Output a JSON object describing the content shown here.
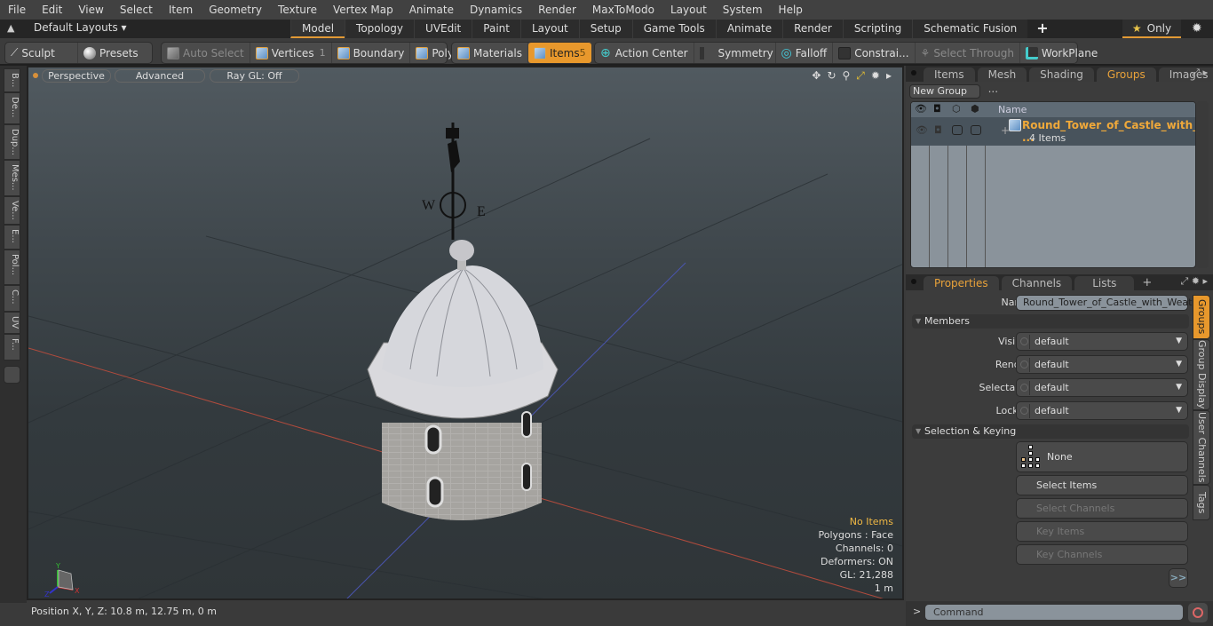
{
  "menubar": [
    "File",
    "Edit",
    "View",
    "Select",
    "Item",
    "Geometry",
    "Texture",
    "Vertex Map",
    "Animate",
    "Dynamics",
    "Render",
    "MaxToModo",
    "Layout",
    "System",
    "Help"
  ],
  "layoutbar": {
    "layout_select": "Default Layouts",
    "tabs": [
      {
        "label": "Model",
        "active": true
      },
      {
        "label": "Topology"
      },
      {
        "label": "UVEdit"
      },
      {
        "label": "Paint"
      },
      {
        "label": "Layout"
      },
      {
        "label": "Setup"
      },
      {
        "label": "Game Tools"
      },
      {
        "label": "Animate"
      },
      {
        "label": "Render"
      },
      {
        "label": "Scripting"
      },
      {
        "label": "Schematic Fusion"
      }
    ],
    "add_tab": "+",
    "only_label": "Only"
  },
  "toolbar": {
    "sculpt": "Sculpt",
    "presets": "Presets",
    "auto_select": "Auto Select",
    "vertices": "Vertices",
    "vertices_count": "1",
    "boundary": "Boundary",
    "polygons": "Polygons",
    "materials": "Materials",
    "items": "Items",
    "items_count": "5",
    "action_center": "Action Center",
    "symmetry": "Symmetry",
    "falloff": "Falloff",
    "constraints": "Constrai...",
    "select_through": "Select Through",
    "workplane": "WorkPlane"
  },
  "left_tabs": [
    "B...",
    "De...",
    "Dup...",
    "Mes...",
    "Ve...",
    "E...",
    "Pol...",
    "C...",
    "UV",
    "F..."
  ],
  "viewport": {
    "view_mode": "Perspective",
    "shading": "Advanced",
    "raygl": "Ray GL: Off",
    "info": {
      "selection": "No Items",
      "polygons": "Polygons : Face",
      "channels": "Channels: 0",
      "deformers": "Deformers: ON",
      "gl": "GL: 21,288",
      "scale": "1 m"
    },
    "axis_labels": {
      "x": "X",
      "y": "Y",
      "z": "Z"
    }
  },
  "statusbar": {
    "position": "Position X, Y, Z:   10.8 m, 12.75 m, 0 m"
  },
  "groups_panel": {
    "tabs": [
      {
        "label": "Items"
      },
      {
        "label": "Mesh ..."
      },
      {
        "label": "Shading"
      },
      {
        "label": "Groups",
        "active": true
      },
      {
        "label": "Images"
      }
    ],
    "new_group": "New Group",
    "column_name": "Name",
    "rows": [
      {
        "name": "Round_Tower_of_Castle_with_ ...",
        "sub": "4 Items"
      }
    ]
  },
  "properties_panel": {
    "tabs": [
      {
        "label": "Properties",
        "active": true
      },
      {
        "label": "Channels"
      },
      {
        "label": "Lists"
      }
    ],
    "name_label": "Name",
    "name_value": "Round_Tower_of_Castle_with_Weath",
    "members_section": "Members",
    "fields": [
      {
        "label": "Visible",
        "value": "default"
      },
      {
        "label": "Render",
        "value": "default"
      },
      {
        "label": "Selectable",
        "value": "default"
      },
      {
        "label": "Locked",
        "value": "default"
      }
    ],
    "selection_section": "Selection & Keying",
    "none_label": "None",
    "buttons": [
      {
        "label": "Select Items",
        "enabled": true
      },
      {
        "label": "Select Channels",
        "enabled": false
      },
      {
        "label": "Key Items",
        "enabled": false
      },
      {
        "label": "Key Channels",
        "enabled": false
      }
    ],
    "more": ">>",
    "side_tabs": [
      {
        "label": "Groups",
        "active": true
      },
      {
        "label": "Group Display"
      },
      {
        "label": "User Channels"
      },
      {
        "label": "Tags"
      }
    ]
  },
  "command": {
    "prompt": ">",
    "placeholder": "Command"
  },
  "colors": {
    "accent": "#e8982c",
    "selection_text": "#f0b844"
  }
}
